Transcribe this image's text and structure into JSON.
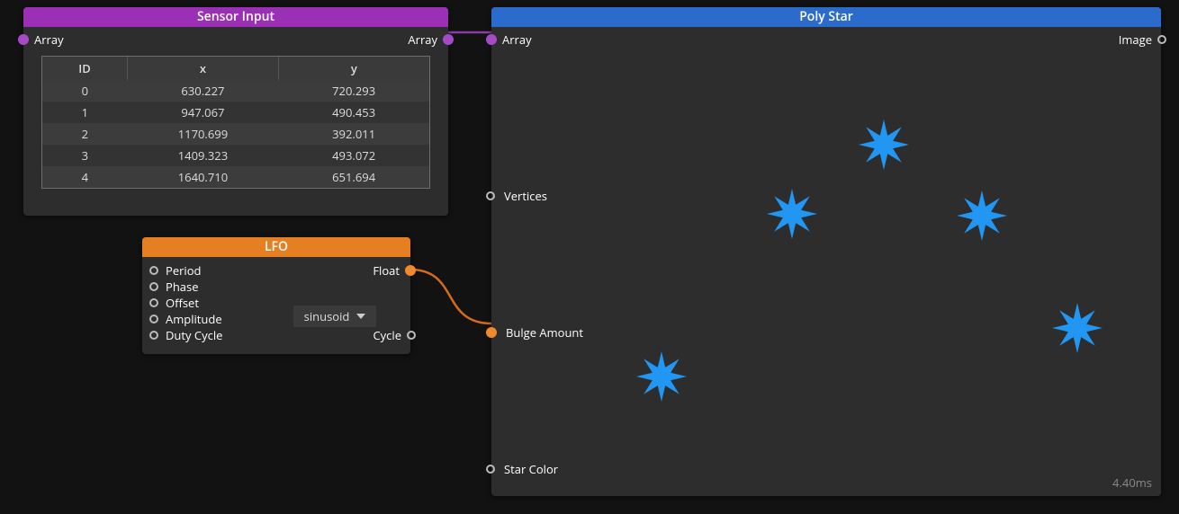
{
  "nodes": {
    "sensor": {
      "title": "Sensor Input",
      "input_label": "Array",
      "output_label": "Array",
      "table": {
        "headers": {
          "id": "ID",
          "x": "x",
          "y": "y"
        },
        "rows": [
          {
            "id": "0",
            "x": "630.227",
            "y": "720.293"
          },
          {
            "id": "1",
            "x": "947.067",
            "y": "490.453"
          },
          {
            "id": "2",
            "x": "1170.699",
            "y": "392.011"
          },
          {
            "id": "3",
            "x": "1409.323",
            "y": "493.072"
          },
          {
            "id": "4",
            "x": "1640.710",
            "y": "651.694"
          }
        ]
      }
    },
    "lfo": {
      "title": "LFO",
      "inputs": [
        "Period",
        "Phase",
        "Offset",
        "Amplitude",
        "Duty Cycle"
      ],
      "output_float": "Float",
      "output_cycle": "Cycle",
      "waveform_selected": "sinusoid"
    },
    "poly": {
      "title": "Poly Star",
      "input_array": "Array",
      "output_image": "Image",
      "param_vertices": "Vertices",
      "param_bulge": "Bulge Amount",
      "param_color": "Star Color",
      "render_time": "4.40ms"
    }
  },
  "chart_data": {
    "type": "table",
    "title": "Sensor Input",
    "columns": [
      "ID",
      "x",
      "y"
    ],
    "rows": [
      [
        0,
        630.227,
        720.293
      ],
      [
        1,
        947.067,
        490.453
      ],
      [
        2,
        1170.699,
        392.011
      ],
      [
        3,
        1409.323,
        493.072
      ],
      [
        4,
        1640.71,
        651.694
      ]
    ]
  }
}
